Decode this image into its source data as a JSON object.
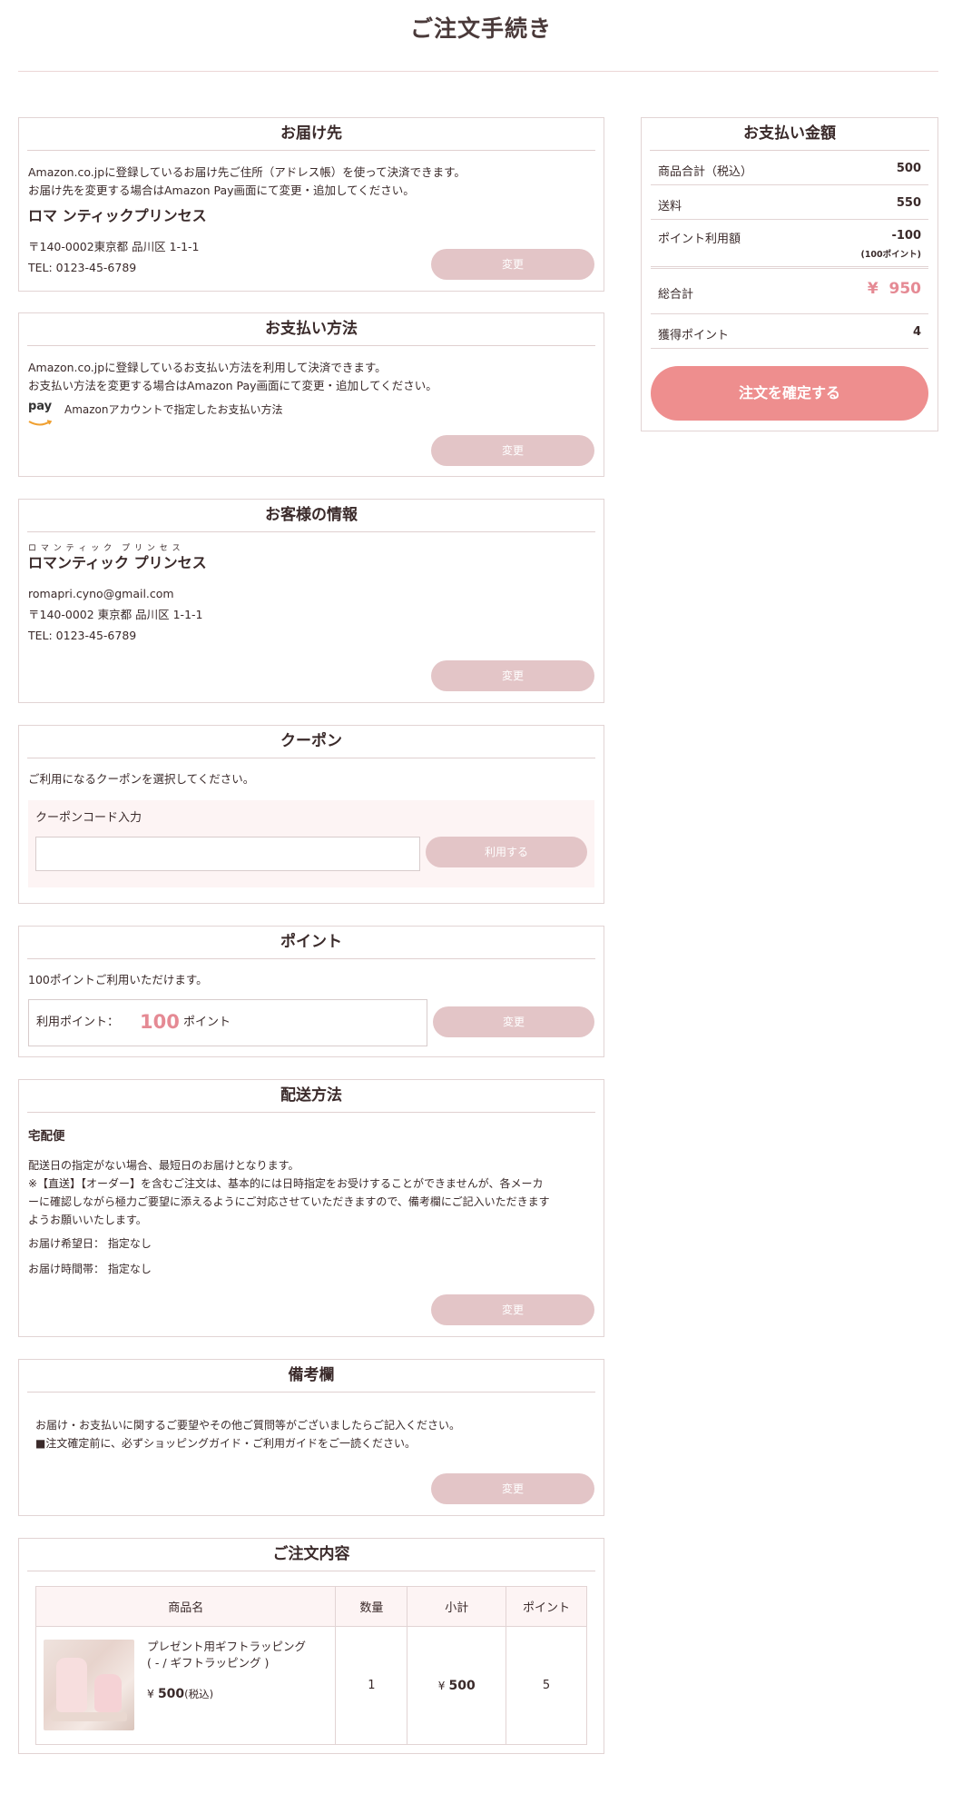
{
  "page": {
    "title": "ご注文手続き"
  },
  "delivery": {
    "heading": "お届け先",
    "line1": "Amazon.co.jpに登録しているお届け先ご住所（アドレス帳）を使って決済できます。",
    "line2": "お届け先を変更する場合はAmazon Pay画面にて変更・追加してください。",
    "name": "ロマ ンティックプリンセス",
    "address": "〒140-0002東京都 品川区 1-1-1",
    "tel": "TEL: 0123-45-6789",
    "button": "変更"
  },
  "payment": {
    "heading": "お支払い方法",
    "line1": "Amazon.co.jpに登録しているお支払い方法を利用して決済できます。",
    "line2": "お支払い方法を変更する場合はAmazon Pay画面にて変更・追加してください。",
    "logo_text": "pay",
    "method": "Amazonアカウントで指定したお支払い方法",
    "button": "変更"
  },
  "customer": {
    "heading": "お客様の情報",
    "ruby": "ロ マ ン テ ィ ッ ク　プ リ ン セ ス",
    "name": "ロマンティック プリンセス",
    "email": "romapri.cyno@gmail.com",
    "address": "〒140-0002 東京都 品川区 1-1-1",
    "tel": "TEL: 0123-45-6789",
    "button": "変更"
  },
  "coupon": {
    "heading": "クーポン",
    "description": "ご利用になるクーポンを選択してください。",
    "input_label": "クーポンコード入力",
    "input_value": "",
    "button": "利用する"
  },
  "points": {
    "heading": "ポイント",
    "description": "100ポイントご利用いただけます。",
    "label": "利用ポイント：",
    "value": "100",
    "unit": "ポイント",
    "button": "変更"
  },
  "shipping": {
    "heading": "配送方法",
    "method": "宅配便",
    "line1": "配送日の指定がない場合、最短日のお届けとなります。",
    "line2": "※【直送】【オーダー】を含むご注文は、基本的には日時指定をお受けすることができませんが、各メーカ",
    "line3": "ーに確認しながら極力ご要望に添えるようにご対応させていただきますので、備考欄にご記入いただきます",
    "line4": "ようお願いいたします。",
    "date_label": "お届け希望日：",
    "date_value": "指定なし",
    "time_label": "お届け時間帯：",
    "time_value": "指定なし",
    "button": "変更"
  },
  "remarks": {
    "heading": "備考欄",
    "line1": "お届け・お支払いに関するご要望やその他ご質問等がございましたらご記入ください。",
    "line2": "■注文確定前に、必ずショッピングガイド・ご利用ガイドをご一読ください。",
    "button": "変更"
  },
  "order": {
    "heading": "ご注文内容",
    "columns": [
      "商品名",
      "数量",
      "小計",
      "ポイント"
    ],
    "item": {
      "name_line1": "プレゼント用ギフトラッピング",
      "name_line2": "( - / ギフトラッピング )",
      "price_symbol": "¥",
      "price": "500",
      "tax_note": "(税込)",
      "quantity": "1",
      "subtotal_symbol": "¥",
      "subtotal": "500",
      "points": "5"
    }
  },
  "summary": {
    "heading": "お支払い金額",
    "subtotal_label": "商品合計（税込）",
    "subtotal_value": "500",
    "shipping_label": "送料",
    "shipping_value": "550",
    "points_label": "ポイント利用額",
    "points_value": "-100",
    "points_note": "(100ポイント)",
    "total_label": "総合計",
    "total_symbol": "¥",
    "total_value": "950",
    "earned_label": "獲得ポイント",
    "earned_value": "4",
    "confirm_button": "注文を確定する"
  },
  "colors": {
    "accent": "#ee8e8e",
    "button_muted": "#e3c5c7",
    "highlight_text": "#e58a94",
    "border": "#e2d4d4"
  }
}
